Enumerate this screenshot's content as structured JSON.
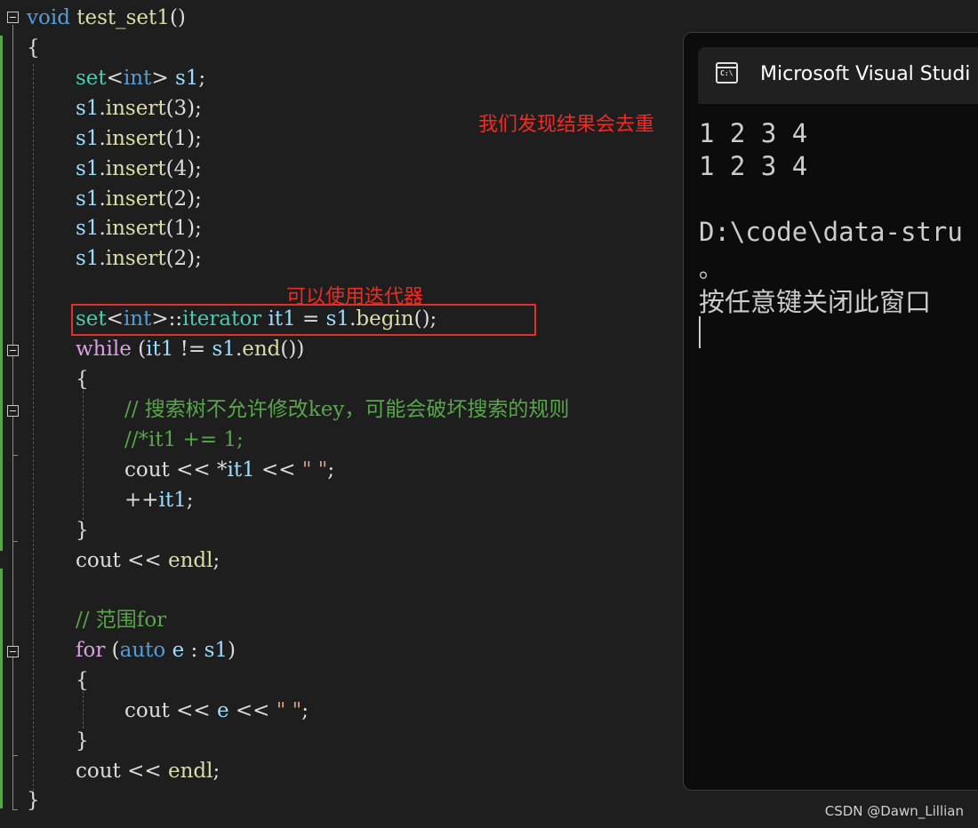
{
  "code": {
    "l1": {
      "kw": "void",
      "name": " test_set1",
      "rest": "()"
    },
    "l2": "{",
    "l3": {
      "t": "set",
      "lt": "<",
      "ty": "int",
      "gt": ">",
      "var": " s1",
      "semi": ";"
    },
    "l4": {
      "var": "s1",
      "dot": ".",
      "fn": "insert",
      "args": "(3);"
    },
    "l5": {
      "var": "s1",
      "dot": ".",
      "fn": "insert",
      "args": "(1);"
    },
    "l6": {
      "var": "s1",
      "dot": ".",
      "fn": "insert",
      "args": "(4);"
    },
    "l7": {
      "var": "s1",
      "dot": ".",
      "fn": "insert",
      "args": "(2);"
    },
    "l8": {
      "var": "s1",
      "dot": ".",
      "fn": "insert",
      "args": "(1);"
    },
    "l9": {
      "var": "s1",
      "dot": ".",
      "fn": "insert",
      "args": "(2);"
    },
    "l10": {
      "t": "set",
      "lt": "<",
      "ty": "int",
      "gt": ">",
      "scope": "::",
      "iter": "iterator",
      "var": " it1",
      "eq": " = ",
      "var2": "s1",
      "dot": ".",
      "fn": "begin",
      "rest": "();"
    },
    "l11": {
      "kw": "while",
      "p1": " (",
      "var": "it1",
      "op": " != ",
      "var2": "s1",
      "dot": ".",
      "fn": "end",
      "rest": "())"
    },
    "l12": "{",
    "l13": "// 搜索树不允许修改key，可能会破坏搜索的规则",
    "l14": "//*it1 += 1;",
    "l15": {
      "a": "cout",
      "b": " << *",
      "c": "it1",
      "d": " << ",
      "e": "\" \"",
      "f": ";"
    },
    "l16": {
      "a": "++",
      "b": "it1",
      "c": ";"
    },
    "l17": "}",
    "l18": {
      "a": "cout",
      "b": " << ",
      "c": "endl",
      "d": ";"
    },
    "l19": "// 范围for",
    "l20": {
      "kw": "for",
      "p1": " (",
      "auto": "auto",
      "var": " e",
      "col": " : ",
      "var2": "s1",
      "rest": ")"
    },
    "l21": "{",
    "l22": {
      "a": "cout",
      "b": " << ",
      "c": "e",
      "d": " << ",
      "e": "\" \"",
      "f": ";"
    },
    "l23": "}",
    "l24": {
      "a": "cout",
      "b": " << ",
      "c": "endl",
      "d": ";"
    },
    "l25": "}"
  },
  "annotations": {
    "dedup": "我们发现结果会去重",
    "iterator": "可以使用迭代器"
  },
  "console": {
    "title": "Microsoft Visual Studi",
    "icon_label": "C:\\",
    "lines": [
      "1 2 3 4",
      "1 2 3 4",
      "D:\\code\\data-stru",
      "。",
      "按任意键关闭此窗口"
    ]
  },
  "watermark": "CSDN @Dawn_Lillian",
  "colors": {
    "keyword": "#569cd6",
    "flow_keyword": "#d8a0df",
    "type": "#4ec9b0",
    "variable": "#9cdcfe",
    "function": "#dcdcaa",
    "comment": "#57a64a",
    "annotation": "#ee2b24"
  }
}
